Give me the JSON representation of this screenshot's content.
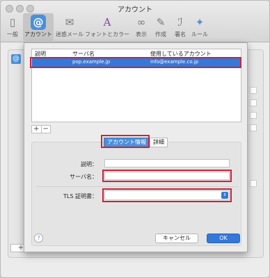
{
  "window": {
    "title": "アカウント"
  },
  "toolbar": {
    "items": [
      {
        "label": "一般",
        "icon": "switch-icon"
      },
      {
        "label": "アカウント",
        "icon": "at-icon"
      },
      {
        "label": "迷惑メール",
        "icon": "junk-icon"
      },
      {
        "label": "フォントとカラー",
        "icon": "font-color-icon"
      },
      {
        "label": "表示",
        "icon": "glasses-icon"
      },
      {
        "label": "作成",
        "icon": "pencil-icon"
      },
      {
        "label": "署名",
        "icon": "signature-icon"
      },
      {
        "label": "ルール",
        "icon": "rules-icon"
      }
    ],
    "selected": "アカウント"
  },
  "account_table": {
    "headers": [
      "説明",
      "サーバ名",
      "使用しているアカウント"
    ],
    "rows": [
      {
        "description": "",
        "server": "pop.example.jp",
        "account": "info@example.co.jp"
      }
    ]
  },
  "list_controls": {
    "add": "+",
    "remove": "−"
  },
  "tabs": {
    "account_info": "アカウント情報",
    "details": "詳細"
  },
  "form": {
    "description_label": "説明：",
    "description_value": "",
    "server_label": "サーバ名：",
    "server_value": "",
    "tls_label": "TLS 証明書：",
    "tls_value": ""
  },
  "buttons": {
    "help": "?",
    "cancel": "キャンセル",
    "ok": "OK"
  },
  "background": {
    "at_icon": "@",
    "pm": "+"
  },
  "colors": {
    "accent": "#3478d8",
    "highlight": "#c8253a"
  }
}
